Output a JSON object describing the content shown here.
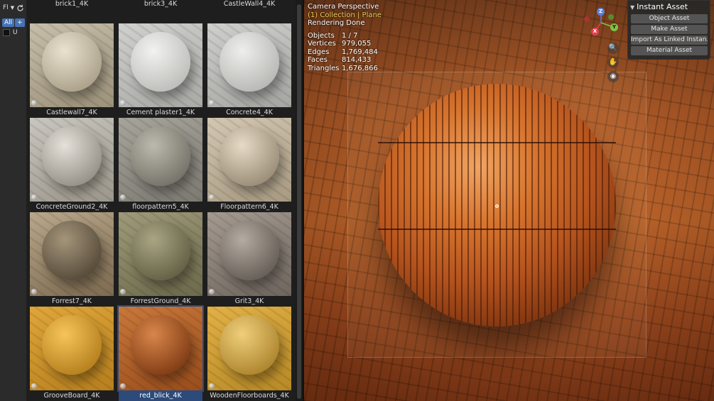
{
  "sidebar": {
    "header_label": "Fl",
    "filter_all": "All",
    "filter_add": "+",
    "u_label": "U"
  },
  "assets": [
    {
      "name": "brick1_4K",
      "colors": [
        "#c4b396",
        "#a8926e"
      ],
      "sphere": [
        "#d8c9ae",
        "#8a7658"
      ],
      "selected": false
    },
    {
      "name": "brick3_4K",
      "colors": [
        "#c6a15c",
        "#9b7a3a"
      ],
      "sphere": [
        "#d7b978",
        "#7c5d2a"
      ],
      "selected": false
    },
    {
      "name": "CastleWall4_4K",
      "colors": [
        "#cbc2b2",
        "#a59b8a"
      ],
      "sphere": [
        "#ddd5c6",
        "#8e8575"
      ],
      "selected": false
    },
    {
      "name": "Castlewall7_4K",
      "colors": [
        "#c7bea9",
        "#9d927a"
      ],
      "sphere": [
        "#e9e2cf",
        "#a69b84"
      ],
      "selected": false
    },
    {
      "name": "Cement plaster1_4K",
      "colors": [
        "#d0d0ce",
        "#a9a9a6"
      ],
      "sphere": [
        "#f2f2f0",
        "#b9b9b6"
      ],
      "selected": false
    },
    {
      "name": "Concrete4_4K",
      "colors": [
        "#cfcfcd",
        "#a5a5a2"
      ],
      "sphere": [
        "#eeeeec",
        "#b3b3b0"
      ],
      "selected": false
    },
    {
      "name": "ConcreteGround2_4K",
      "colors": [
        "#c9c6bf",
        "#9c978c"
      ],
      "sphere": [
        "#e4e1da",
        "#8f8a80"
      ],
      "selected": false
    },
    {
      "name": "floorpattern5_4K",
      "colors": [
        "#a7a49b",
        "#7d7a72"
      ],
      "sphere": [
        "#bcb9ae",
        "#6f6c63"
      ],
      "selected": false
    },
    {
      "name": "Floorpattern6_4K",
      "colors": [
        "#d3c7b2",
        "#a89a82"
      ],
      "sphere": [
        "#e6dbc6",
        "#948670"
      ],
      "selected": false
    },
    {
      "name": "Forrest7_4K",
      "colors": [
        "#b9a78b",
        "#7e6b50"
      ],
      "sphere": [
        "#a4947a",
        "#4f4433"
      ],
      "selected": false
    },
    {
      "name": "ForrestGround_4K",
      "colors": [
        "#9f9a79",
        "#6d6a4c"
      ],
      "sphere": [
        "#a9a584",
        "#5d5a3f"
      ],
      "selected": false
    },
    {
      "name": "Grit3_4K",
      "colors": [
        "#a49a90",
        "#6f665e"
      ],
      "sphere": [
        "#b4aba2",
        "#5f5750"
      ],
      "selected": false
    },
    {
      "name": "GrooveBoard_4K",
      "colors": [
        "#e0a63a",
        "#b8801e"
      ],
      "sphere": [
        "#f6c45a",
        "#b07a18"
      ],
      "selected": false
    },
    {
      "name": "red_blick_4K",
      "colors": [
        "#c9783a",
        "#9a4d1c"
      ],
      "sphere": [
        "#d8864a",
        "#7a3610"
      ],
      "selected": true
    },
    {
      "name": "WoodenFloorboards_4K",
      "colors": [
        "#e2b046",
        "#b88a26"
      ],
      "sphere": [
        "#efcf7a",
        "#a87e28"
      ],
      "selected": false
    }
  ],
  "viewport": {
    "view_name": "Camera Perspective",
    "collection": "(1) Collection | Plane",
    "status": "Rendering Done",
    "stats": [
      {
        "label": "Objects",
        "value": "1 / 7"
      },
      {
        "label": "Vertices",
        "value": "979,055"
      },
      {
        "label": "Edges",
        "value": "1,769,484"
      },
      {
        "label": "Faces",
        "value": "814,433"
      },
      {
        "label": "Triangles",
        "value": "1,676,866"
      }
    ],
    "gizmo": {
      "z": "Z",
      "y": "Y",
      "x": "X"
    }
  },
  "npanel": {
    "title": "Instant Asset",
    "buttons": [
      "Object Asset",
      "Make Asset",
      "Import As Linked Instan...",
      "Material Asset"
    ]
  },
  "colors": {
    "selection": "#2c4a7a",
    "accent": "#4772b3"
  }
}
